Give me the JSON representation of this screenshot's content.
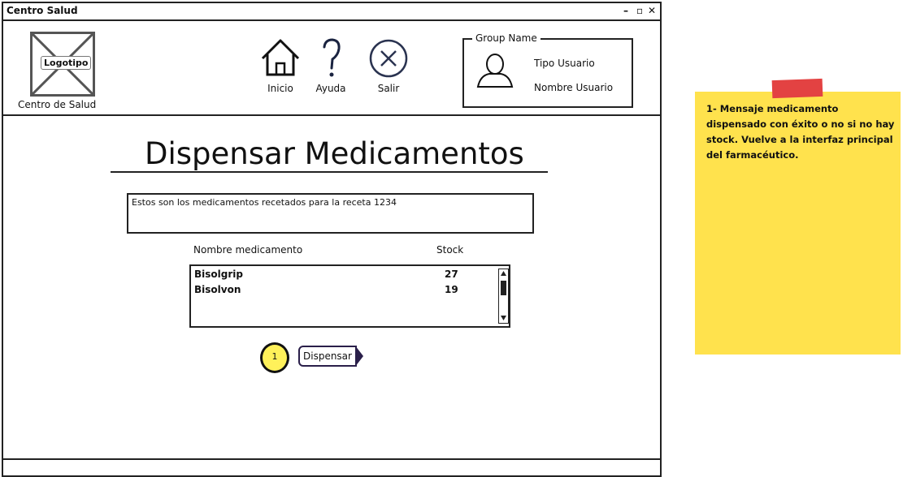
{
  "window": {
    "title": "Centro Salud",
    "controls": [
      "–",
      "▫",
      "✕"
    ]
  },
  "header": {
    "logo": {
      "label": "Logotipo",
      "caption": "Centro de Salud"
    },
    "nav": [
      {
        "label": "Inicio",
        "icon": "home-icon"
      },
      {
        "label": "Ayuda",
        "icon": "help-icon"
      },
      {
        "label": "Salir",
        "icon": "close-circle-icon"
      }
    ],
    "group": {
      "legend": "Group Name",
      "user_type": "Tipo Usuario",
      "user_name": "Nombre Usuario",
      "icon": "user-icon"
    }
  },
  "main": {
    "title": "Dispensar Medicamentos",
    "message": "Estos son los medicamentos recetados para la receta 1234",
    "columns": {
      "name": "Nombre medicamento",
      "stock": "Stock"
    },
    "items": [
      {
        "name": "Bisolgrip",
        "stock": "27"
      },
      {
        "name": "Bisolvon",
        "stock": "19"
      }
    ],
    "badge": "1",
    "dispense_label": "Dispensar"
  },
  "note": {
    "text": "1- Mensaje medicamento dispensado con éxito o no si no hay stock. Vuelve a la interfaz principal del farmacéutico."
  },
  "colors": {
    "note": "#ffe24d",
    "tape": "#e34242",
    "badge": "#fff15a"
  }
}
